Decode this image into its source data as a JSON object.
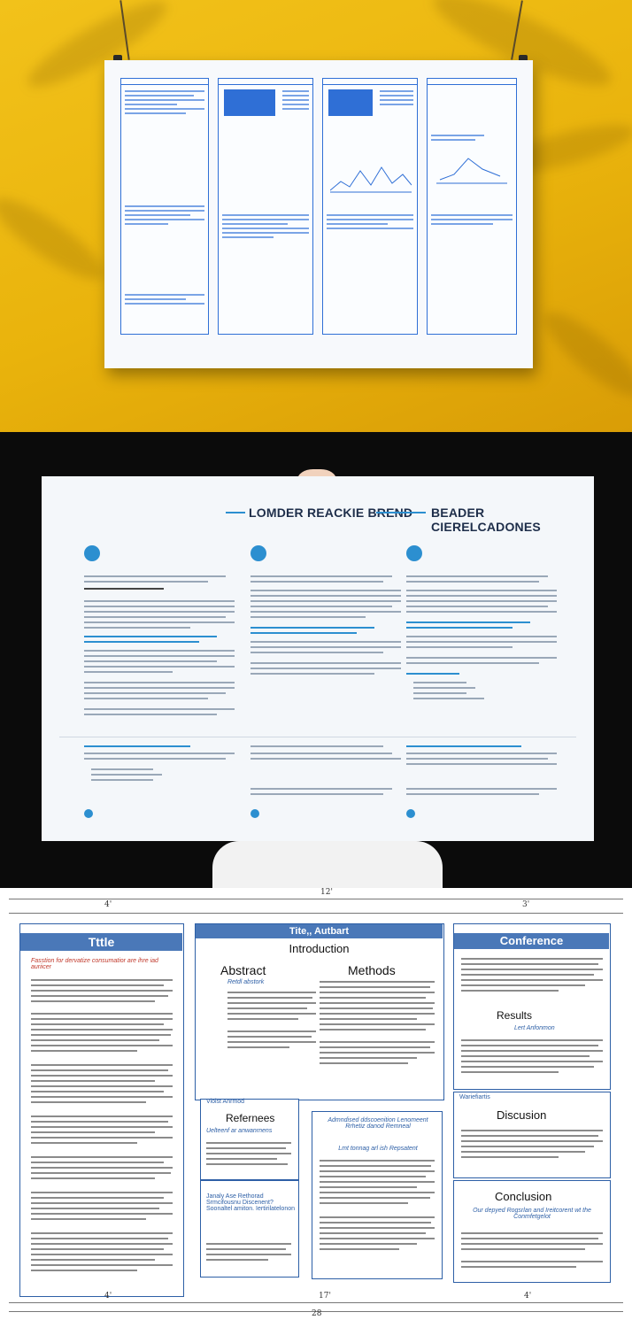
{
  "panel2": {
    "title_left": "LOMDER REACKIE BREND",
    "title_right": "BEADER CIERELCADONES"
  },
  "panel3": {
    "dims": {
      "top_center": "12'",
      "top_left": "4'",
      "top_right": "3'",
      "bottom_left": "4'",
      "bottom_center": "17'",
      "bottom_right": "4'",
      "bottom_total": "28"
    },
    "left": {
      "bar": "Tttle",
      "lead": "Fasstion for dervatize consumatior are ihre iad auriicer"
    },
    "center_top": {
      "bar": "Tite,, Autbart",
      "heading": "Introduction",
      "abstract": "Abstract",
      "abstract_sub": "Retdl abstork",
      "methods": "Methods",
      "refs_tag": "Violst Anrmod",
      "references": "Refernees",
      "references_sub": "Uelteenf ar anwanrnens"
    },
    "center_low": {
      "lead": "Admndised ddscoenition Lenomeent Rrhetiz danod Remneal",
      "sub": "Lmt tonnag arl ish Repsatent",
      "left_sub": "Janaly Ase Rethorad Srmcifousnu Discenent? Soonaltel amiton. Iertirilatelonon"
    },
    "right": {
      "bar": "Conference",
      "results": "Results",
      "results_sub": "Lert Anfonmon",
      "tag": "Wariefiartis",
      "discussion": "Discusion",
      "conclusion": "Conclusion",
      "conclusion_sub": "Our depyed Rogsrlan and Ireitcorent wt the Conmfetgelot"
    }
  }
}
